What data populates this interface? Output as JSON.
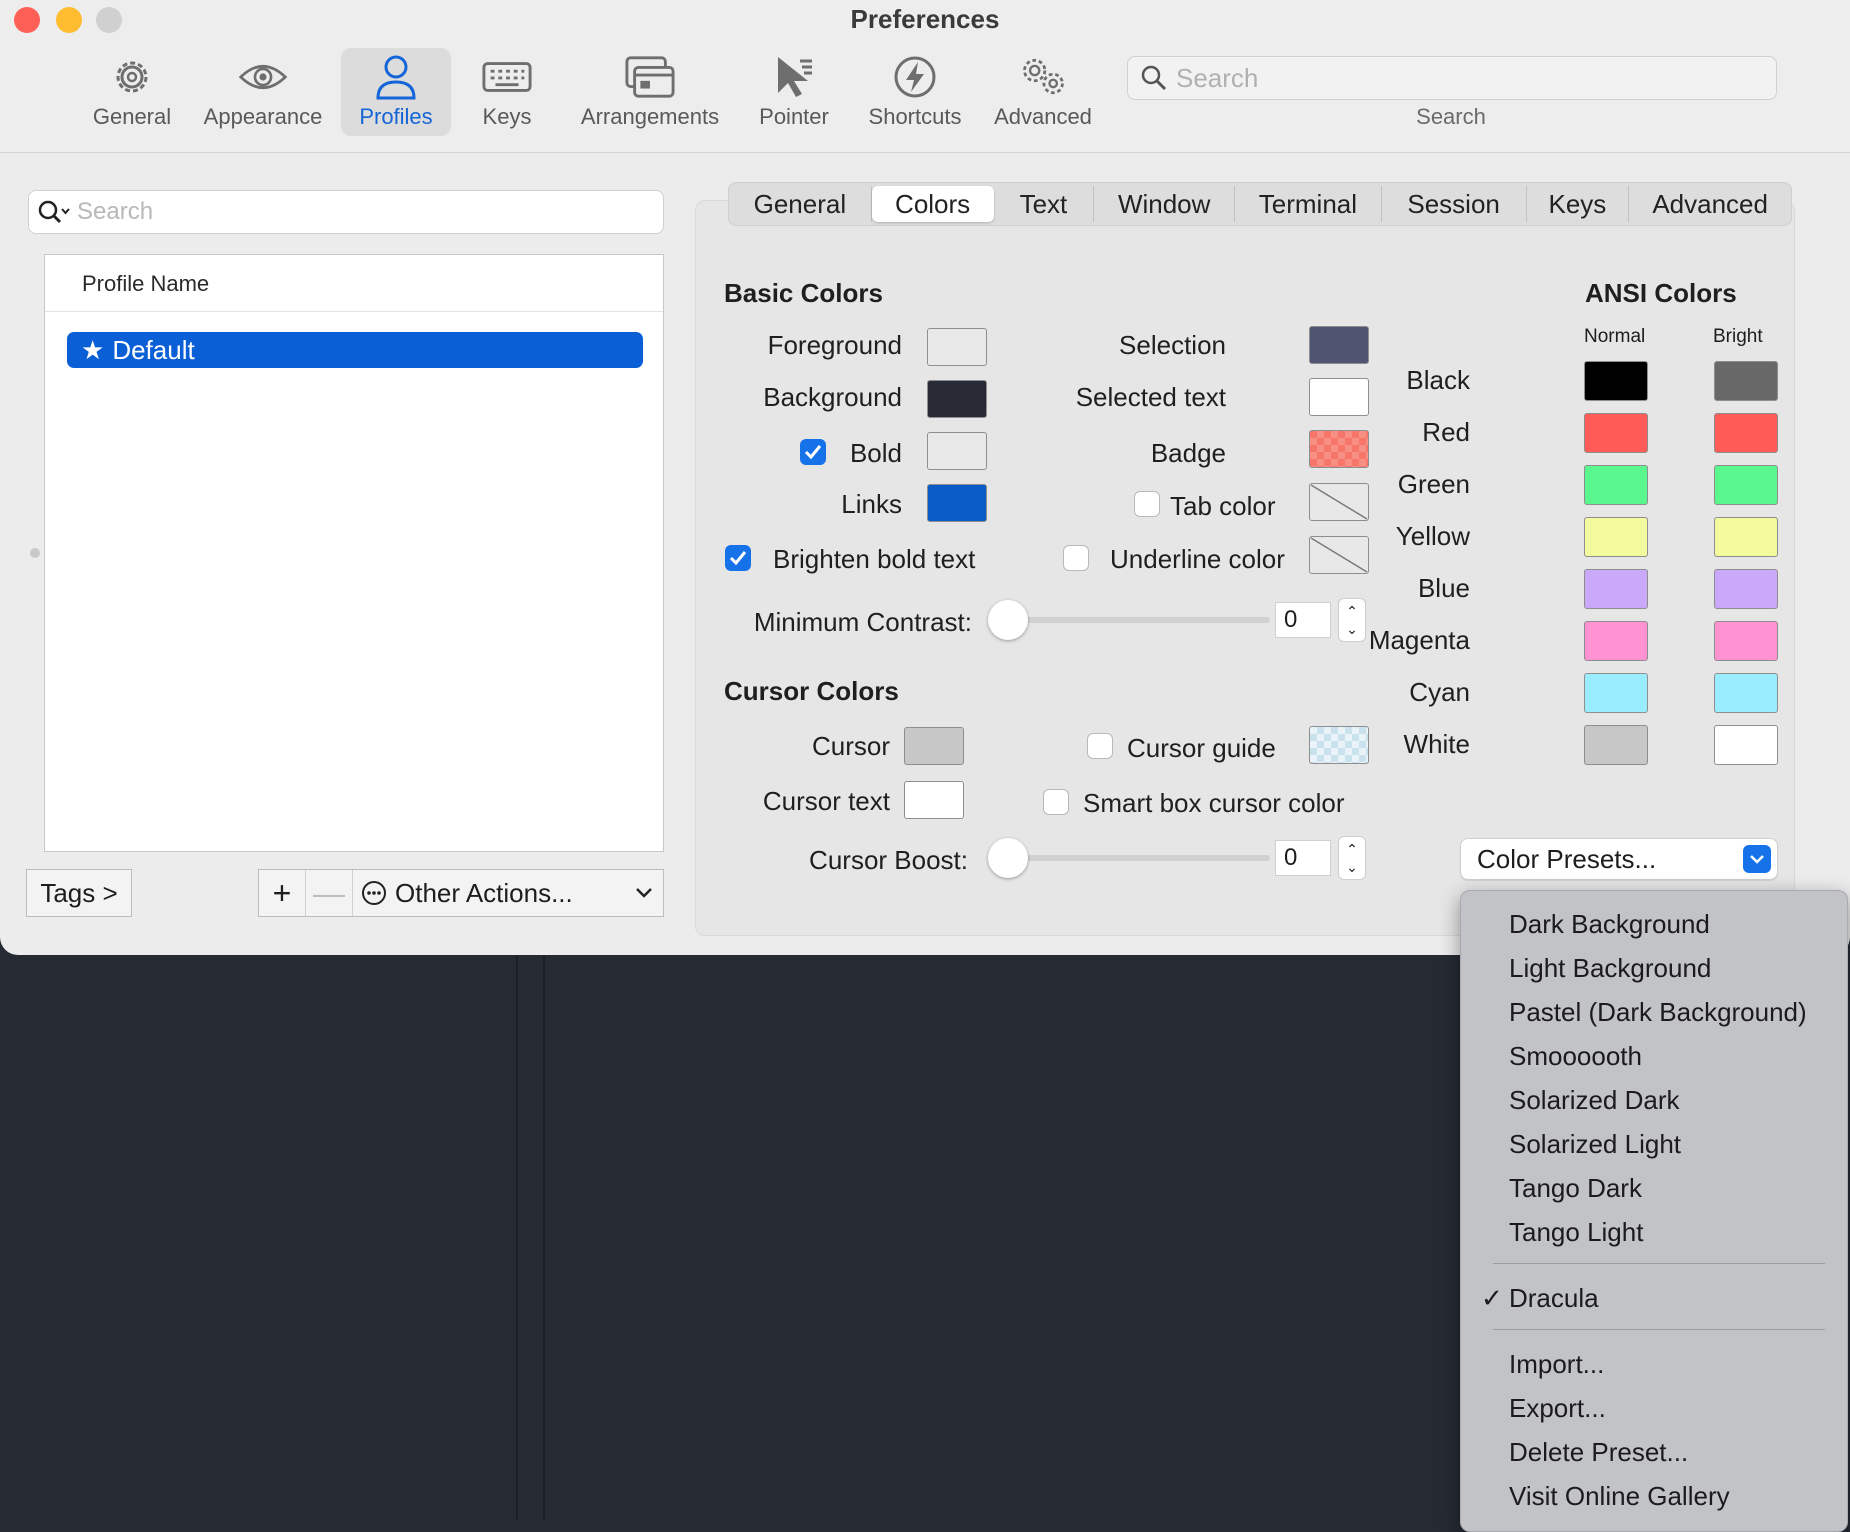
{
  "window": {
    "title": "Preferences"
  },
  "toolbar": {
    "items": [
      {
        "label": "General",
        "icon": "gear-icon"
      },
      {
        "label": "Appearance",
        "icon": "eye-icon"
      },
      {
        "label": "Profiles",
        "icon": "person-icon"
      },
      {
        "label": "Keys",
        "icon": "keyboard-icon"
      },
      {
        "label": "Arrangements",
        "icon": "windows-icon"
      },
      {
        "label": "Pointer",
        "icon": "pointer-icon"
      },
      {
        "label": "Shortcuts",
        "icon": "bolt-icon"
      },
      {
        "label": "Advanced",
        "icon": "gears-icon"
      }
    ],
    "active": "Profiles",
    "search_placeholder": "Search",
    "search_caption": "Search"
  },
  "profiles": {
    "search_placeholder": "Search",
    "column_header": "Profile Name",
    "items": [
      {
        "name": "Default",
        "selected": true
      }
    ],
    "tags_label": "Tags >",
    "add_label": "+",
    "remove_label": "—",
    "other_actions_label": "Other Actions..."
  },
  "subtabs": {
    "items": [
      "General",
      "Colors",
      "Text",
      "Window",
      "Terminal",
      "Session",
      "Keys",
      "Advanced"
    ],
    "active": "Colors"
  },
  "basic_colors": {
    "title": "Basic Colors",
    "foreground_label": "Foreground",
    "foreground_color": "#e9e9e9",
    "background_label": "Background",
    "background_color": "#282a36",
    "bold_label": "Bold",
    "bold_checked": true,
    "bold_color": "#e9e9e9",
    "links_label": "Links",
    "links_color": "#0b5bc9",
    "selection_label": "Selection",
    "selection_color": "#4f5571",
    "selected_text_label": "Selected text",
    "selected_text_color": "#ffffff",
    "badge_label": "Badge",
    "badge_color": "#f7766a",
    "tab_color_label": "Tab color",
    "tab_color_checked": false,
    "underline_color_label": "Underline color",
    "underline_color_checked": false,
    "brighten_bold_label": "Brighten bold text",
    "brighten_bold_checked": true,
    "min_contrast_label": "Minimum Contrast:",
    "min_contrast_value": "0"
  },
  "cursor_colors": {
    "title": "Cursor Colors",
    "cursor_label": "Cursor",
    "cursor_color": "#c7c7c7",
    "cursor_text_label": "Cursor text",
    "cursor_text_color": "#ffffff",
    "cursor_guide_label": "Cursor guide",
    "cursor_guide_checked": false,
    "smart_box_label": "Smart box cursor color",
    "smart_box_checked": false,
    "cursor_boost_label": "Cursor Boost:",
    "cursor_boost_value": "0"
  },
  "ansi": {
    "title": "ANSI Colors",
    "normal_header": "Normal",
    "bright_header": "Bright",
    "rows": [
      {
        "name": "Black",
        "normal": "#000000",
        "bright": "#686868"
      },
      {
        "name": "Red",
        "normal": "#ff5c57",
        "bright": "#ff5c57"
      },
      {
        "name": "Green",
        "normal": "#5af78e",
        "bright": "#5af78e"
      },
      {
        "name": "Yellow",
        "normal": "#f3f99d",
        "bright": "#f3f99d"
      },
      {
        "name": "Blue",
        "normal": "#caa9fa",
        "bright": "#caa9fa"
      },
      {
        "name": "Magenta",
        "normal": "#ff92d0",
        "bright": "#ff92d0"
      },
      {
        "name": "Cyan",
        "normal": "#9aedfe",
        "bright": "#9aedfe"
      },
      {
        "name": "White",
        "normal": "#c7c7c7",
        "bright": "#ffffff"
      }
    ]
  },
  "presets": {
    "button_label": "Color Presets...",
    "menu_group1": [
      "Dark Background",
      "Light Background",
      "Pastel (Dark Background)",
      "Smoooooth",
      "Solarized Dark",
      "Solarized Light",
      "Tango Dark",
      "Tango Light"
    ],
    "checked_item": "Dracula",
    "checkmark": "✓",
    "menu_group3": [
      "Import...",
      "Export...",
      "Delete Preset...",
      "Visit Online Gallery"
    ]
  }
}
